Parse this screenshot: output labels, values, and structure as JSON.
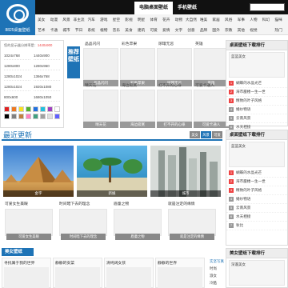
{
  "header": {
    "tabs": [
      {
        "label": "电脑桌面壁纸",
        "active": true
      },
      {
        "label": "手机壁纸",
        "active": false
      }
    ],
    "search_placeholder": ""
  },
  "logo": {
    "name": "8825桌面壁纸"
  },
  "categories": {
    "row1": [
      "美女",
      "动漫",
      "风景",
      "非主流",
      "汽车",
      "游戏",
      "星空",
      "影视",
      "明星",
      "体育",
      "花卉",
      "动物",
      "大自然",
      "唯美",
      "家居",
      "风俗",
      "军事",
      "人物",
      "科幻",
      "猫咪"
    ],
    "row2": [
      "艺术",
      "卡通",
      "城市",
      "节日",
      "系统",
      "植物",
      "音乐",
      "美食",
      "建筑",
      "可爱",
      "爱情",
      "文字",
      "创意",
      "品牌",
      "国外",
      "宗教",
      "其他",
      "视觉",
      "",
      "热门"
    ]
  },
  "resolution": {
    "hint_prefix": "您的显示器分辨率是：",
    "hint_value": "1440x900",
    "sizes": [
      "1024x768",
      "1440x900",
      "1280x800",
      "1280x960",
      "1280x1024",
      "1366x768",
      "1280x1024",
      "1920x1080",
      "800x600",
      "1680x1050"
    ]
  },
  "swatch_colors": [
    "#e02020",
    "#f07820",
    "#f8e020",
    "#50b030",
    "#2070e0",
    "#20c0e0",
    "#a040c0",
    "#ffffff",
    "#000000",
    "#808080",
    "#c08040",
    "#ff80c0",
    "#40a080",
    "#a0a0a0",
    "#e0e0e0",
    "#6060ff"
  ],
  "recommend": {
    "label": "推荐壁纸"
  },
  "top_thumbs": [
    {
      "title": "晶晶闪闪",
      "bar": "晶晶闪闪"
    },
    {
      "title": "彩色苹果",
      "bar": "彩色苹果"
    },
    {
      "title": "尿罐无忌",
      "bar": "尿罐无忌"
    },
    {
      "title": "英雄",
      "bar": "英雄"
    },
    {
      "title": "晴天花",
      "bar": "晴天花"
    },
    {
      "title": "海边寂寞",
      "bar": "海边寂寞"
    },
    {
      "title": "打不开的心扉",
      "bar": "打不开的心扉"
    },
    {
      "title": "可爱卡通人",
      "bar": "可爱卡通人"
    }
  ],
  "rank_top": {
    "title": "桌面壁纸下载排行",
    "feature": "蓝蓝美女",
    "items": [
      "蝴蝶的水晶光芒",
      "海市蜃楼一生一世",
      "精致的叶子风格",
      "婚纱物语",
      "云南风景",
      "水天相接",
      "秋比"
    ]
  },
  "latest": {
    "title": "最近更新",
    "buttons": [
      "美女",
      "风景",
      "可爱"
    ],
    "photos": [
      {
        "caption": "金字"
      },
      {
        "caption": "新娘"
      },
      {
        "caption": "城市"
      }
    ],
    "thumbs": [
      {
        "title": "可爱女生美眼",
        "bar": "可爱女生美眼"
      },
      {
        "title": "时间暗下去的理念",
        "bar": "时间暗下去的理念"
      },
      {
        "title": "眉童之物",
        "bar": "眉童之物"
      },
      {
        "title": "就是注定的缘情",
        "bar": "就是注定的缘情"
      }
    ]
  },
  "bottom": {
    "section_title": "美女壁纸",
    "cards": [
      {
        "title": "寻找属于我的世界"
      },
      {
        "title": "静静的安菜"
      },
      {
        "title": "清纯阔女孩"
      },
      {
        "title": "静静的世界"
      }
    ],
    "side_links": [
      "实坚写真",
      "时尚",
      "淑女",
      "冷酷"
    ],
    "rank_title": "美女壁纸下载排行",
    "rank_item": "深邃美女"
  }
}
